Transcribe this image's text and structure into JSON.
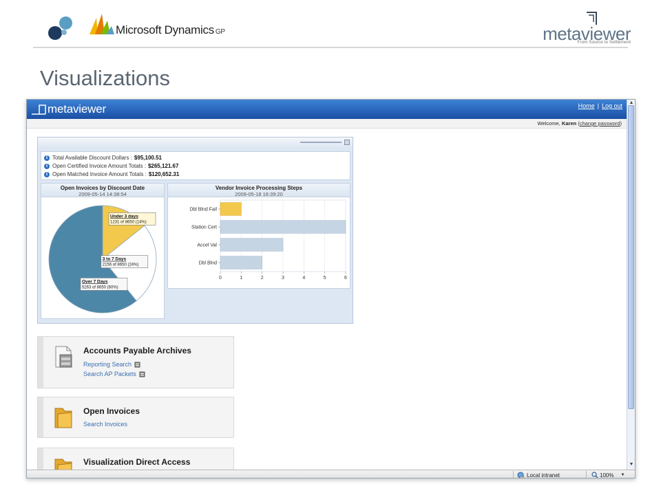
{
  "slide": {
    "ms_logo_text": "Microsoft Dynamics",
    "ms_logo_suffix": "GP",
    "vendor_logo_text": "metaviewer",
    "vendor_tagline": "From Source to Settlement",
    "title": "Visualizations"
  },
  "app": {
    "logo_text": "metaviewer",
    "nav": {
      "home": "Home",
      "separator": "|",
      "logout": "Log out"
    },
    "welcome_prefix": "Welcome,",
    "user_name": "Karen",
    "change_password": "change password"
  },
  "stats": [
    {
      "label": "Total Available Discount Dollars :",
      "value": "$95,100.51"
    },
    {
      "label": "Open Certified Invoice Amount Totals :",
      "value": "$265,121.67"
    },
    {
      "label": "Open Matched Invoice Amount Totals :",
      "value": "$120,652.31"
    }
  ],
  "pie_chart": {
    "title": "Open Invoices by Discount Date",
    "timestamp": "2009-05-14 14:38:54",
    "total": 8650
  },
  "bar_chart": {
    "title": "Vendor Invoice Processing Steps",
    "timestamp": "2009-05-18 16:39:20"
  },
  "chart_data": [
    {
      "type": "pie",
      "title": "Open Invoices by Discount Date",
      "slices": [
        {
          "label": "Under 3 days",
          "value": 1231,
          "detail": "1231 of 8650 (14%)",
          "color": "#f2c94c"
        },
        {
          "label": "3 to 7 Days",
          "value": 2156,
          "detail": "2156 of 8650 (24%)",
          "color": "#ffffff"
        },
        {
          "label": "Over 7 Days",
          "value": 5263,
          "detail": "5263 of 8650 (60%)",
          "color": "#4d87a8"
        }
      ]
    },
    {
      "type": "bar",
      "orientation": "horizontal",
      "title": "Vendor Invoice Processing Steps",
      "categories": [
        "Dbl Blnd Fail",
        "Station Cert",
        "Accel Val",
        "Dbl Blnd"
      ],
      "values": [
        1,
        6,
        3,
        2
      ],
      "colors": [
        "#f2c94c",
        "#c6d5e3",
        "#c6d5e3",
        "#c6d5e3"
      ],
      "xlim": [
        0,
        6
      ],
      "xticks": [
        0,
        1,
        2,
        3,
        4,
        5,
        6
      ]
    }
  ],
  "cards": {
    "ap_archives": {
      "title": "Accounts Payable Archives",
      "links": [
        "Reporting Search",
        "Search AP Packets"
      ]
    },
    "open_invoices": {
      "title": "Open Invoices",
      "links": [
        "Search Invoices"
      ]
    },
    "viz_access": {
      "title": "Visualization Direct Access"
    }
  },
  "status_bar": {
    "zone": "Local intranet",
    "zoom": "100%"
  },
  "colors": {
    "app_bar_top": "#3d82d6",
    "app_bar_bottom": "#1a4fa3",
    "link": "#3a6fb0",
    "accent_yellow": "#f2c94c",
    "accent_blue": "#4d87a8"
  }
}
